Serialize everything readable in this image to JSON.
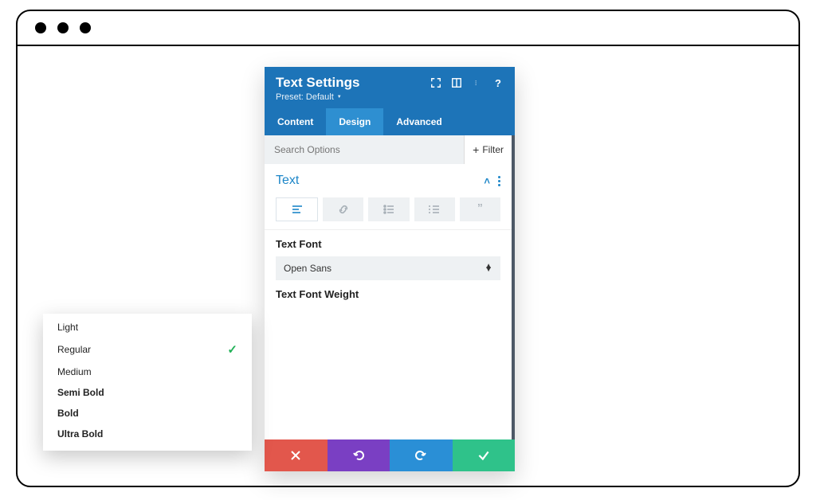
{
  "header": {
    "title": "Text Settings",
    "preset_label": "Preset: Default"
  },
  "tabs": {
    "content": "Content",
    "design": "Design",
    "advanced": "Advanced"
  },
  "search": {
    "placeholder": "Search Options",
    "filter_label": "Filter"
  },
  "section": {
    "name": "Text"
  },
  "fields": {
    "font_label": "Text Font",
    "font_value": "Open Sans",
    "weight_label": "Text Font Weight"
  },
  "weight_options": {
    "light": "Light",
    "regular": "Regular",
    "medium": "Medium",
    "semi": "Semi Bold",
    "bold": "Bold",
    "ultra": "Ultra Bold",
    "selected": "Regular"
  }
}
